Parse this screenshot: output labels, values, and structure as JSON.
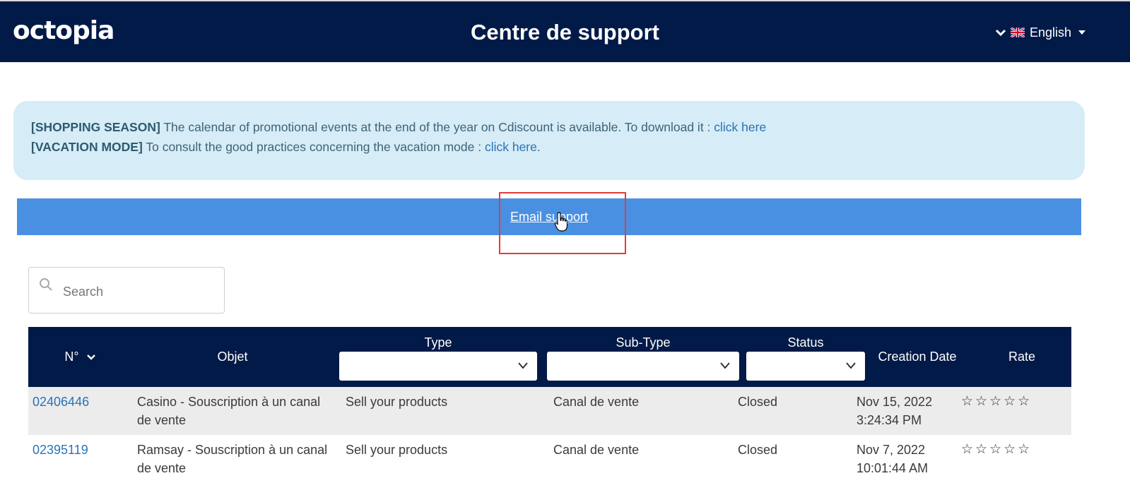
{
  "header": {
    "logo_text": "octopia",
    "title": "Centre de support",
    "language": "English"
  },
  "alert": {
    "line1_tag": "[SHOPPING SEASON]",
    "line1_text": " The calendar of promotional events at the end of the year on Cdiscount is available. To download it : ",
    "line1_link": "click here",
    "line2_tag": "[VACATION MODE]",
    "line2_text": " To consult the good practices concerning the vacation mode : ",
    "line2_link": "click here",
    "line2_end": "."
  },
  "email_support": {
    "label": "Email support"
  },
  "search": {
    "placeholder": "Search"
  },
  "table": {
    "columns": {
      "number": "N°",
      "objet": "Objet",
      "type": "Type",
      "subtype": "Sub-Type",
      "status": "Status",
      "creation_date": "Creation Date",
      "rate": "Rate"
    },
    "rows": [
      {
        "number": "02406446",
        "objet_line1": "Casino - Souscription à un canal",
        "objet_line2": "de vente",
        "type": "Sell your products",
        "subtype": "Canal de vente",
        "status": "Closed",
        "date_line1": "Nov 15, 2022",
        "date_line2": "3:24:34 PM",
        "rate": "☆☆☆☆☆"
      },
      {
        "number": "02395119",
        "objet_line1": "Ramsay - Souscription à un canal",
        "objet_line2": "de vente",
        "type": "Sell your products",
        "subtype": "Canal de vente",
        "status": "Closed",
        "date_line1": "Nov 7, 2022",
        "date_line2": "10:01:44 AM",
        "rate": "☆☆☆☆☆"
      }
    ]
  },
  "colors": {
    "navy": "#021a47",
    "alert_bg": "#d6ecf6",
    "email_bar": "#4a90e2",
    "link": "#2a73b8",
    "highlight": "#e63b3b"
  }
}
